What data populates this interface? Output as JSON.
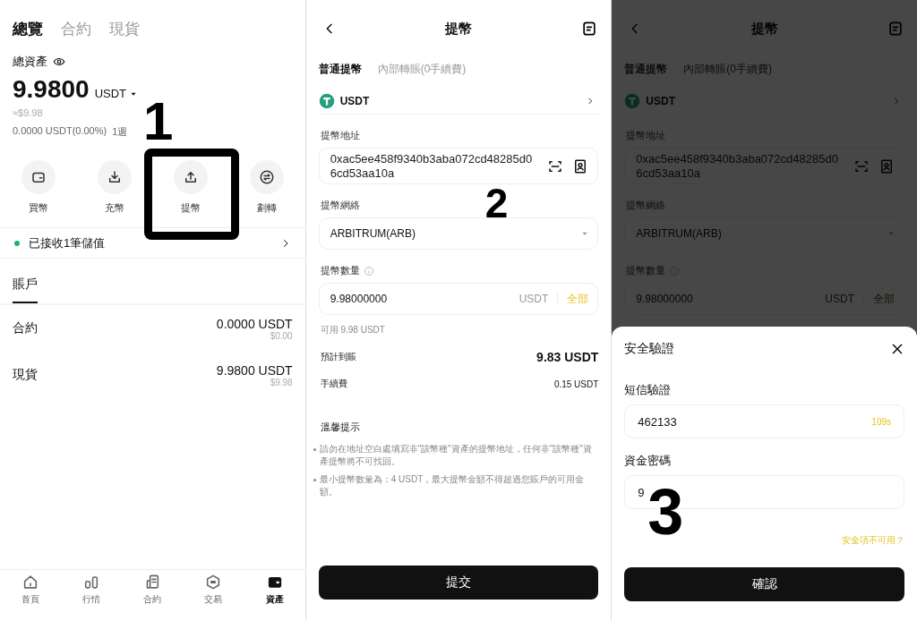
{
  "assets_screen": {
    "tabs": [
      {
        "label": "總覽",
        "selected": true
      },
      {
        "label": "合約",
        "selected": false
      },
      {
        "label": "現貨",
        "selected": false
      }
    ],
    "total_label": "總資產",
    "total_value": "9.9800",
    "total_unit": "USDT",
    "approx": "≈$9.98",
    "change": "0.0000 USDT(0.00%)",
    "period": "1週",
    "actions": [
      {
        "label": "買幣",
        "kind": "buy"
      },
      {
        "label": "充幣",
        "kind": "deposit"
      },
      {
        "label": "提幣",
        "kind": "withdraw"
      },
      {
        "label": "劃轉",
        "kind": "transfer"
      }
    ],
    "notice": "已接收1筆儲值",
    "account_tabs": [
      {
        "label": "賬戶",
        "selected": true
      }
    ],
    "accounts": [
      {
        "name": "合約",
        "amount": "0.0000 USDT",
        "fiat": "$0.00"
      },
      {
        "name": "現貨",
        "amount": "9.9800 USDT",
        "fiat": "$9.98"
      }
    ],
    "nav": [
      {
        "label": "首頁",
        "kind": "home",
        "selected": false
      },
      {
        "label": "行情",
        "kind": "market",
        "selected": false
      },
      {
        "label": "合約",
        "kind": "futures",
        "selected": false
      },
      {
        "label": "交易",
        "kind": "trade",
        "selected": false
      },
      {
        "label": "資產",
        "kind": "assets",
        "selected": true
      }
    ],
    "annotation": {
      "label": "1",
      "boxed": true
    }
  },
  "withdraw_screen": {
    "title": "提幣",
    "tabs": [
      {
        "label": "普通提幣",
        "selected": true
      },
      {
        "label": "內部轉賬(0手續費)",
        "selected": false
      }
    ],
    "coin": "USDT",
    "address_label": "提幣地址",
    "address": "0xac5ee458f9340b3aba072cd48285d06cd53aa10a",
    "network_label": "提幣網絡",
    "network": "ARBITRUM(ARB)",
    "amount_label": "提幣數量",
    "amount": "9.98000000",
    "amount_unit": "USDT",
    "max_button": "全部",
    "available": "可用 9.98 USDT",
    "rows": [
      {
        "label": "預計到賬",
        "value": "9.83 USDT",
        "kind": "primary"
      },
      {
        "label": "手續費",
        "value": "0.15 USDT",
        "kind": "secondary"
      }
    ],
    "tips_title": "溫馨提示",
    "tips": [
      "請勿在地址空白處填寫非\"該幣種\"資產的提幣地址，任何非\"該幣種\"資產提幣將不可找回。",
      "最小提幣數量為：4 USDT，最大提幣金額不得超過您賬戶的可用金額。"
    ],
    "submit": "提交",
    "annotation": {
      "label": "2"
    }
  },
  "confirm_screen": {
    "background": {
      "title": "提幣",
      "tabs": [
        {
          "label": "普通提幣",
          "selected": true
        },
        {
          "label": "內部轉賬(0手續費)",
          "selected": false
        }
      ],
      "coin": "USDT",
      "address_label": "提幣地址",
      "address": "0xac5ee458f9340b3aba072cd48285d06cd53aa10a",
      "network_label": "提幣網絡",
      "network": "ARBITRUM(ARB)",
      "amount_label": "提幣數量",
      "amount": "9.98000000",
      "amount_unit": "USDT",
      "max_button": "全部"
    },
    "dialog": {
      "title": "安全驗證",
      "sms_label": "短信驗證",
      "sms_code": "462133",
      "countdown": "109s",
      "password_label": "資金密碼",
      "password": "9",
      "help_link": "安全項不可用？",
      "confirm": "確認"
    },
    "annotation": {
      "label": "3"
    }
  }
}
